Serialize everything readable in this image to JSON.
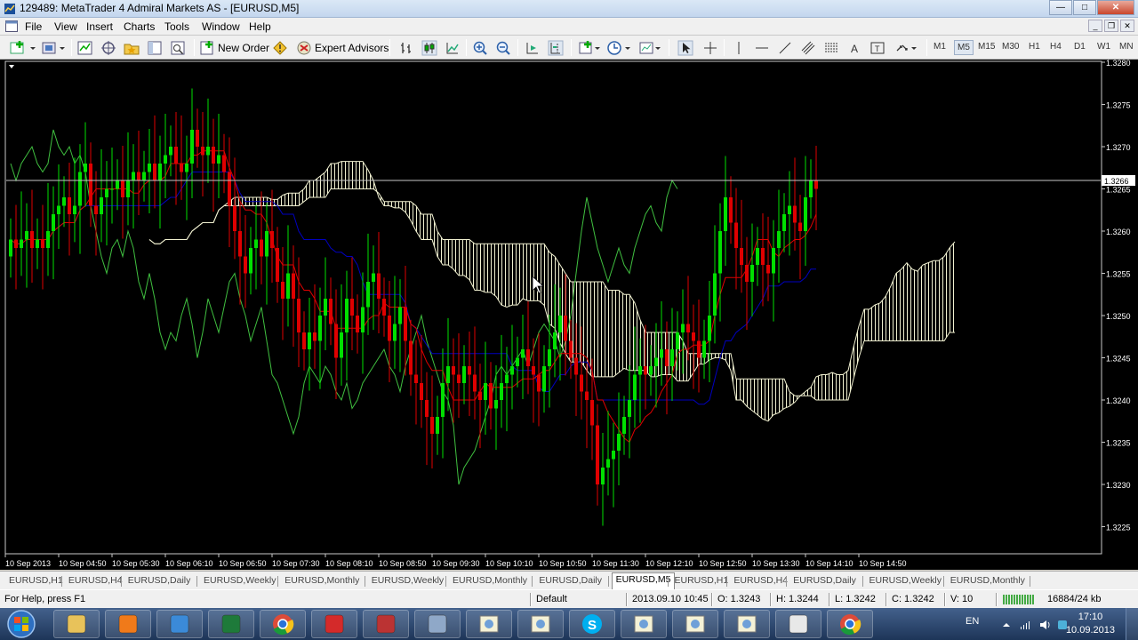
{
  "window": {
    "title": "129489: MetaTrader 4 Admiral Markets AS - [EURUSD,M5]"
  },
  "menu": [
    "File",
    "View",
    "Insert",
    "Charts",
    "Tools",
    "Window",
    "Help"
  ],
  "toolbar": {
    "new_order": "New Order",
    "expert_advisors": "Expert Advisors",
    "timeframes": [
      "M1",
      "M5",
      "M15",
      "M30",
      "H1",
      "H4",
      "D1",
      "W1",
      "MN"
    ],
    "active_timeframe": "M5"
  },
  "chart_data": {
    "type": "candlestick",
    "symbol": "EURUSD",
    "timeframe": "M5",
    "ylim": [
      1.3222,
      1.328
    ],
    "y_ticks": [
      "1.3280",
      "1.3275",
      "1.3270",
      "1.3265",
      "1.3260",
      "1.3255",
      "1.3250",
      "1.3245",
      "1.3240",
      "1.3235",
      "1.3230",
      "1.3225"
    ],
    "current_price_label": "1.3266",
    "x_ticks": [
      "10 Sep 2013",
      "10 Sep 04:50",
      "10 Sep 05:30",
      "10 Sep 06:10",
      "10 Sep 06:50",
      "10 Sep 07:30",
      "10 Sep 08:10",
      "10 Sep 08:50",
      "10 Sep 09:30",
      "10 Sep 10:10",
      "10 Sep 10:50",
      "10 Sep 11:30",
      "10 Sep 12:10",
      "10 Sep 12:50",
      "10 Sep 13:30",
      "10 Sep 14:10",
      "10 Sep 14:50"
    ],
    "bull_color": "#00e000",
    "bear_color": "#e00000",
    "tenkan_color": "#e00000",
    "kijun_color": "#0000c0",
    "chikou_color": "#40c040",
    "cloud_color": "#f0f0d0",
    "close": [
      1.3259,
      1.3258,
      1.3259,
      1.326,
      1.3258,
      1.3259,
      1.3258,
      1.326,
      1.3262,
      1.3263,
      1.3264,
      1.3262,
      1.3263,
      1.3267,
      1.3268,
      1.3263,
      1.3262,
      1.3264,
      1.3265,
      1.3265,
      1.3266,
      1.3264,
      1.3266,
      1.3267,
      1.3266,
      1.3267,
      1.3268,
      1.3266,
      1.3268,
      1.3269,
      1.327,
      1.3268,
      1.3267,
      1.3268,
      1.3272,
      1.327,
      1.3269,
      1.327,
      1.3268,
      1.3269,
      1.3267,
      1.3263,
      1.326,
      1.3257,
      1.3255,
      1.3258,
      1.3259,
      1.3257,
      1.326,
      1.3258,
      1.3254,
      1.3252,
      1.3255,
      1.3252,
      1.3248,
      1.3246,
      1.3248,
      1.3247,
      1.325,
      1.3252,
      1.3249,
      1.3245,
      1.3248,
      1.3252,
      1.325,
      1.3248,
      1.3251,
      1.3254,
      1.3255,
      1.3252,
      1.325,
      1.3247,
      1.3249,
      1.3251,
      1.3247,
      1.3243,
      1.3242,
      1.324,
      1.3238,
      1.3236,
      1.3238,
      1.3242,
      1.3244,
      1.3243,
      1.3242,
      1.3244,
      1.3243,
      1.3241,
      1.324,
      1.3242,
      1.3239,
      1.324,
      1.3242,
      1.3243,
      1.3244,
      1.3245,
      1.3246,
      1.3244,
      1.3243,
      1.3241,
      1.3244,
      1.3246,
      1.3248,
      1.325,
      1.3247,
      1.3245,
      1.3243,
      1.3241,
      1.324,
      1.3237,
      1.323,
      1.3232,
      1.3233,
      1.3234,
      1.3236,
      1.3238,
      1.324,
      1.3243,
      1.3244,
      1.3243,
      1.3244,
      1.3245,
      1.3246,
      1.3244,
      1.3246,
      1.3248,
      1.3249,
      1.3248,
      1.3247,
      1.3245,
      1.3247,
      1.325,
      1.3255,
      1.326,
      1.3264,
      1.3261,
      1.3258,
      1.3256,
      1.3254,
      1.3256,
      1.3258,
      1.3256,
      1.3255,
      1.3258,
      1.326,
      1.3262,
      1.3263,
      1.3261,
      1.326,
      1.3264,
      1.3266,
      1.3265
    ]
  },
  "tabs": [
    "EURUSD,H1",
    "EURUSD,H4",
    "EURUSD,Daily",
    "EURUSD,Weekly",
    "EURUSD,Monthly",
    "EURUSD,Weekly",
    "EURUSD,Monthly",
    "EURUSD,Daily",
    "EURUSD,M5",
    "EURUSD,H1",
    "EURUSD,H4",
    "EURUSD,Daily",
    "EURUSD,Weekly",
    "EURUSD,Monthly"
  ],
  "active_tab_index": 8,
  "status": {
    "help": "For Help, press F1",
    "profile": "Default",
    "datetime": "2013.09.10 10:45",
    "open": "O: 1.3243",
    "high": "H: 1.3244",
    "low": "L: 1.3242",
    "close": "C: 1.3242",
    "volume": "V: 10",
    "traffic": "16884/24 kb"
  },
  "taskbar": {
    "lang": "EN",
    "time": "17:10",
    "date": "10.09.2013",
    "apps": [
      "explorer-icon",
      "media-player-icon",
      "internet-explorer-icon",
      "excel-icon",
      "chrome-icon",
      "opera-icon",
      "access-icon",
      "blank-window-icon",
      "metatrader-icon",
      "metatrader-icon",
      "skype-icon",
      "metatrader-icon",
      "metatrader-icon",
      "metatrader-icon",
      "document-icon",
      "chrome-recording-icon"
    ]
  }
}
